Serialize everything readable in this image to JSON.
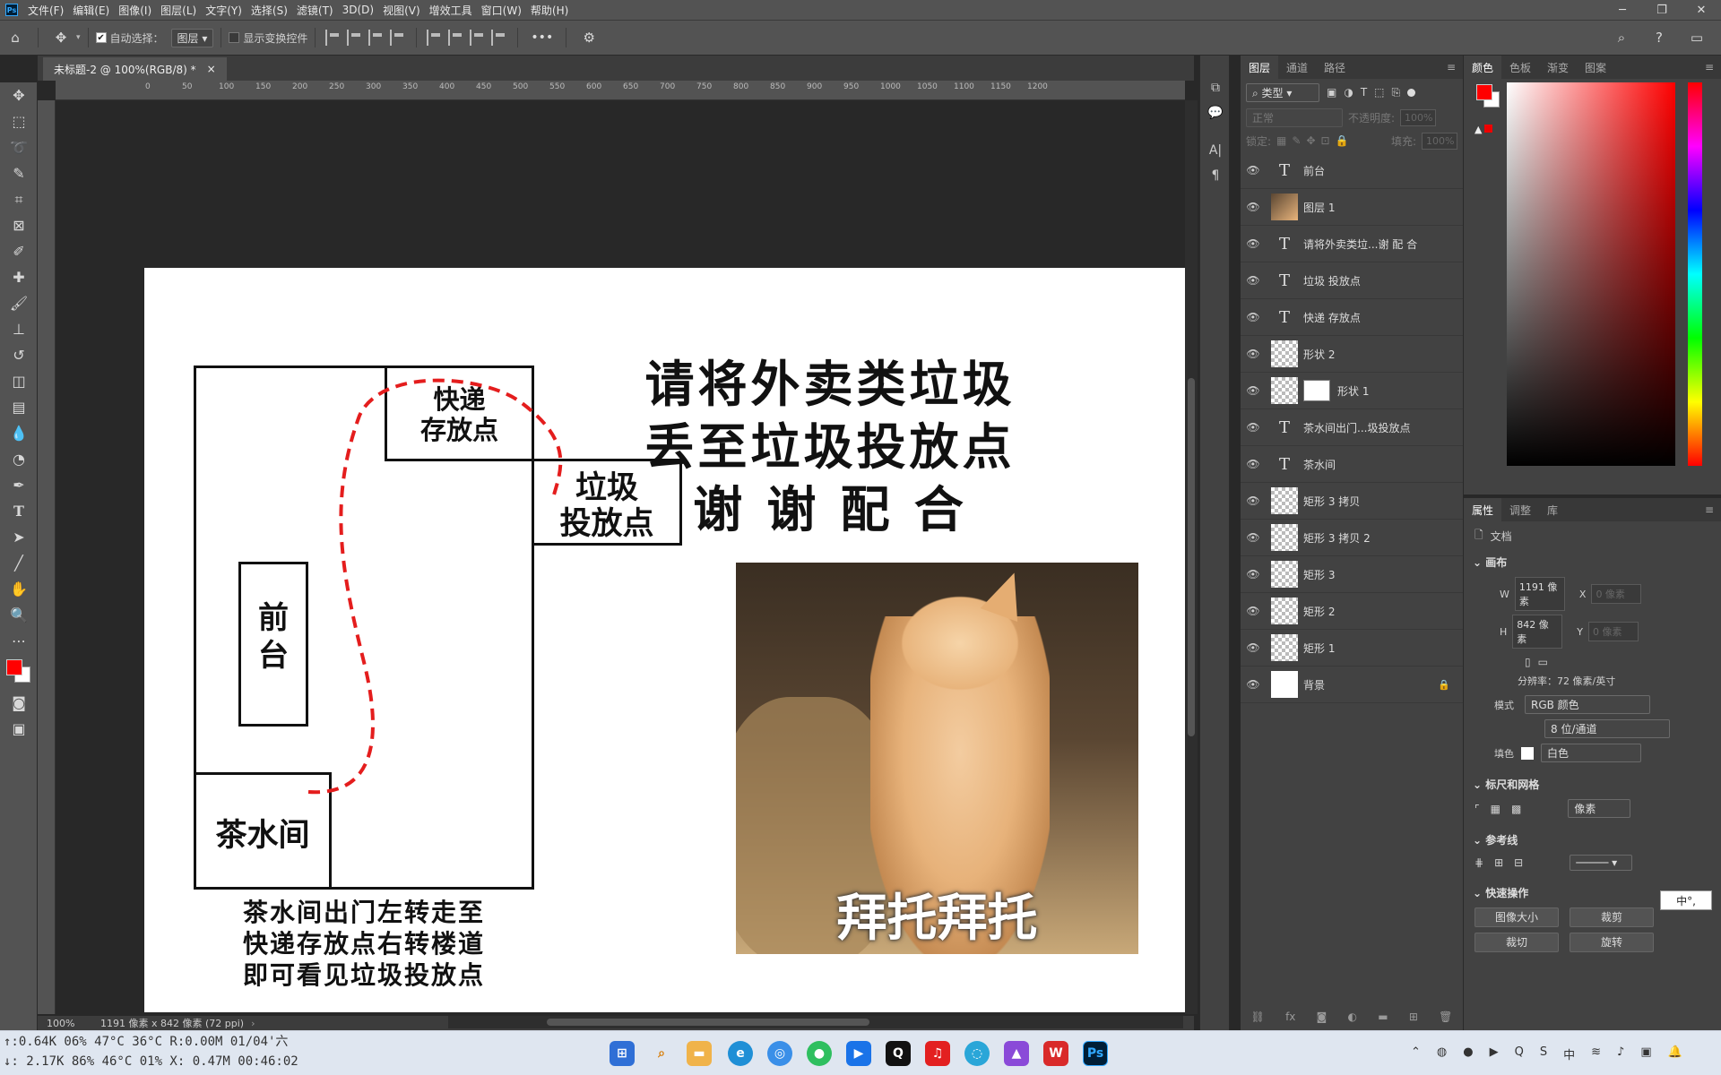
{
  "app": {
    "logo": "Ps"
  },
  "menu": [
    "文件(F)",
    "编辑(E)",
    "图像(I)",
    "图层(L)",
    "文字(Y)",
    "选择(S)",
    "滤镜(T)",
    "3D(D)",
    "视图(V)",
    "增效工具",
    "窗口(W)",
    "帮助(H)"
  ],
  "options": {
    "auto_select_label": "自动选择：",
    "auto_select_value": "图层",
    "show_transform_label": "显示变换控件",
    "more": "•••"
  },
  "document": {
    "tab_title": "未标题-2 @ 100%(RGB/8) *",
    "close": "×"
  },
  "ruler_ticks": [
    "0",
    "50",
    "100",
    "150",
    "200",
    "250",
    "300",
    "350",
    "400",
    "450",
    "500",
    "550",
    "600",
    "650",
    "700",
    "750",
    "800",
    "850",
    "900",
    "950",
    "1000",
    "1050",
    "1100",
    "1150",
    "1200"
  ],
  "artwork": {
    "express_label": "快递\n存放点",
    "trash_label": "垃圾\n投放点",
    "front_desk": "前\n台",
    "tea_room": "茶水间",
    "heading": "请将外卖类垃圾\n丢至垃圾投放点\n谢 谢 配 合",
    "directions": "茶水间出门左转走至\n快递存放点右转楼道\n即可看见垃圾投放点",
    "meme_caption": "拜托拜托"
  },
  "status": {
    "zoom": "100%",
    "doc_info": "1191 像素 x 842 像素 (72 ppi)"
  },
  "layers": {
    "tabs": [
      "图层",
      "通道",
      "路径"
    ],
    "filter_kind": "类型",
    "blend_mode": "正常",
    "opacity_label": "不透明度:",
    "opacity_value": "100%",
    "lock_label": "锁定:",
    "fill_label": "填充:",
    "fill_value": "100%",
    "items": [
      {
        "name": "前台",
        "kind": "text"
      },
      {
        "name": "图层 1",
        "kind": "image"
      },
      {
        "name": "请将外卖类垃...谢 配 合",
        "kind": "text"
      },
      {
        "name": "垃圾 投放点",
        "kind": "text"
      },
      {
        "name": "快递 存放点",
        "kind": "text"
      },
      {
        "name": "形状 2",
        "kind": "shape"
      },
      {
        "name": "形状 1",
        "kind": "shape-mask"
      },
      {
        "name": "茶水间出门...圾投放点",
        "kind": "text"
      },
      {
        "name": "茶水间",
        "kind": "text"
      },
      {
        "name": "矩形 3 拷贝",
        "kind": "shape"
      },
      {
        "name": "矩形 3 拷贝 2",
        "kind": "shape"
      },
      {
        "name": "矩形 3",
        "kind": "shape"
      },
      {
        "name": "矩形 2",
        "kind": "shape"
      },
      {
        "name": "矩形 1",
        "kind": "shape"
      },
      {
        "name": "背景",
        "kind": "background"
      }
    ]
  },
  "color_panel": {
    "tabs": [
      "颜色",
      "色板",
      "渐变",
      "图案"
    ],
    "foreground": "#ff0000",
    "background": "#ffffff"
  },
  "properties": {
    "tabs": [
      "属性",
      "调整",
      "库"
    ],
    "doc_label": "文档",
    "canvas_section": "画布",
    "w_label": "W",
    "w_value": "1191 像素",
    "h_label": "H",
    "h_value": "842 像素",
    "x_label": "X",
    "x_value": "0 像素",
    "y_label": "Y",
    "y_value": "0 像素",
    "resolution": "分辨率：72 像素/英寸",
    "mode_label": "模式",
    "mode_value": "RGB 颜色",
    "bit_value": "8 位/通道",
    "fill_label": "填色",
    "fill_value": "白色",
    "rulers_section": "标尺和网格",
    "ruler_unit": "像素",
    "guides_section": "参考线",
    "quick_section": "快速操作",
    "quick_buttons": [
      "图像大小",
      "裁剪",
      "裁切",
      "旋转"
    ]
  },
  "ime": "中°,",
  "sysmon": {
    "line1": "↑:0.64K 06% 47°C 36°C R:0.00M 01/04'六",
    "line2": "↓: 2.17K 86% 46°C  01% X: 0.47M 00:46:02"
  }
}
